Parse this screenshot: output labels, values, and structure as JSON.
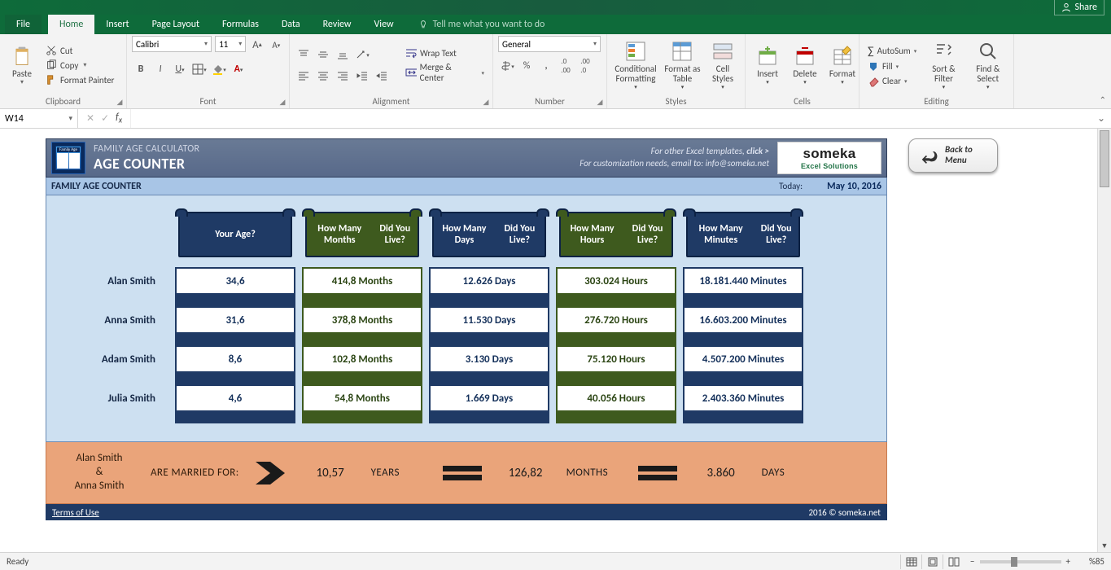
{
  "app": {
    "share": "Share"
  },
  "tabs": {
    "file": "File",
    "home": "Home",
    "insert": "Insert",
    "pageLayout": "Page Layout",
    "formulas": "Formulas",
    "data": "Data",
    "review": "Review",
    "view": "View",
    "tellMe": "Tell me what you want to do"
  },
  "ribbon": {
    "clipboard": {
      "paste": "Paste",
      "cut": "Cut",
      "copy": "Copy",
      "formatPainter": "Format Painter",
      "label": "Clipboard"
    },
    "font": {
      "name": "Calibri",
      "size": "11",
      "label": "Font"
    },
    "alignment": {
      "wrap": "Wrap Text",
      "merge": "Merge & Center",
      "label": "Alignment"
    },
    "number": {
      "format": "General",
      "label": "Number"
    },
    "styles": {
      "conditional": "Conditional Formatting",
      "asTable": "Format as Table",
      "cellStyles": "Cell Styles",
      "label": "Styles"
    },
    "cells": {
      "insert": "Insert",
      "delete": "Delete",
      "format": "Format",
      "label": "Cells"
    },
    "editing": {
      "autosum": "AutoSum",
      "fill": "Fill",
      "clear": "Clear",
      "sortFilter": "Sort & Filter",
      "findSelect": "Find & Select",
      "label": "Editing"
    }
  },
  "nameBox": "W14",
  "sheet": {
    "header": {
      "sub": "FAMILY AGE CALCULATOR",
      "main": "AGE COUNTER",
      "line1a": "For other Excel templates, ",
      "line1b": "click >",
      "line2a": "For customization needs, email to: ",
      "line2b": "info@someka.net",
      "brand": "someka",
      "brandSub": "Excel Solutions"
    },
    "backMenu": {
      "l1": "Back to",
      "l2": "Menu"
    },
    "sub": {
      "title": "FAMILY AGE COUNTER",
      "todayLabel": "Today:",
      "date": "May 10, 2016"
    },
    "columns": {
      "c1": "Your Age?",
      "c2a": "How Many Months",
      "c2b": "Did You Live?",
      "c3a": "How Many Days",
      "c3b": "Did You Live?",
      "c4a": "How Many Hours",
      "c4b": "Did You Live?",
      "c5a": "How Many Minutes",
      "c5b": "Did You Live?"
    },
    "people": [
      {
        "name": "Alan Smith",
        "age": "34,6",
        "months": "414,8 Months",
        "days": "12.626 Days",
        "hours": "303.024 Hours",
        "minutes": "18.181.440 Minutes"
      },
      {
        "name": "Anna Smith",
        "age": "31,6",
        "months": "378,8 Months",
        "days": "11.530 Days",
        "hours": "276.720 Hours",
        "minutes": "16.603.200 Minutes"
      },
      {
        "name": "Adam Smith",
        "age": "8,6",
        "months": "102,8 Months",
        "days": "3.130 Days",
        "hours": "75.120 Hours",
        "minutes": "4.507.200 Minutes"
      },
      {
        "name": "Julia Smith",
        "age": "4,6",
        "months": "54,8 Months",
        "days": "1.669 Days",
        "hours": "40.056 Hours",
        "minutes": "2.403.360 Minutes"
      }
    ],
    "married": {
      "p1": "Alan Smith",
      "amp": "&",
      "p2": "Anna Smith",
      "text": "ARE MARRIED FOR:",
      "years": "10,57",
      "yearsU": "YEARS",
      "months": "126,82",
      "monthsU": "MONTHS",
      "days": "3.860",
      "daysU": "DAYS"
    },
    "footer": {
      "terms": "Terms of Use",
      "copy": "2016 © someka.net"
    }
  },
  "status": {
    "ready": "Ready",
    "zoom": "%85"
  }
}
